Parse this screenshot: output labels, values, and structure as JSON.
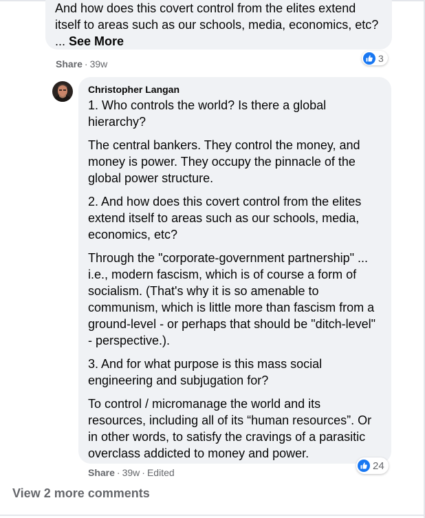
{
  "parent_comment": {
    "text": "And how does this covert control from the elites extend itself to areas such as our schools, media, economics, etc? ...",
    "see_more": "See More",
    "reaction_count": "3",
    "share": "Share",
    "time": "39w"
  },
  "reply": {
    "author": "Christopher Langan",
    "paragraphs": [
      "1. Who controls the world? Is there a global hierarchy?",
      "The central bankers. They control the money, and money is power. They occupy the pinnacle of the global power structure.",
      "2. And how does this covert control from the elites extend itself to areas such as our schools, media, economics, etc?",
      "Through the \"corporate-government partnership\" ... i.e., modern fascism, which is of course a form of socialism. (That's why it is so amenable to communism, which is little more than fascism from a ground-level - or perhaps that should be \"ditch-level\" - perspective.).",
      "3. And for what purpose is this mass social engineering and subjugation for?",
      "To control / micromanage the world and its resources, including all of its “human resources”. Or in other words, to satisfy the cravings of a parasitic overclass addicted to money and power."
    ],
    "reaction_count": "24",
    "share": "Share",
    "time": "39w",
    "edited": "Edited"
  },
  "view_more_comments": "View 2 more comments",
  "colors": {
    "bubble": "#f0f2f5",
    "like_blue": "#1877f2",
    "meta_gray": "#65676b"
  },
  "icons": {
    "reaction": "like-thumb-icon"
  }
}
